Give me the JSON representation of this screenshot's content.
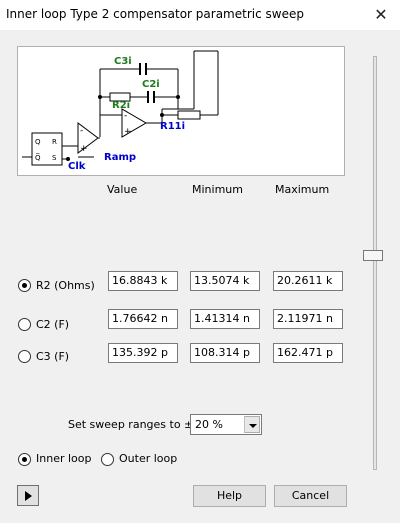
{
  "window": {
    "title": "Inner loop Type 2 compensator parametric sweep",
    "close_glyph": "✕"
  },
  "schematic": {
    "labels": {
      "c3i": "C3i",
      "c2i": "C2i",
      "r2i": "R2i",
      "r11i": "R11i",
      "ramp": "Ramp",
      "clk": "Clk",
      "q": "Q",
      "r": "R",
      "qbar": "Q̅",
      "s": "S",
      "minus": "-",
      "plus": "+"
    },
    "colors": {
      "green": "#1e7b1e",
      "blue": "#0000cc"
    }
  },
  "columns": {
    "value": "Value",
    "minimum": "Minimum",
    "maximum": "Maximum"
  },
  "rows": [
    {
      "label": "R2 (Ohms)",
      "selected": true,
      "value": "16.8843 k",
      "minimum": "13.5074 k",
      "maximum": "20.2611 k"
    },
    {
      "label": "C2 (F)",
      "selected": false,
      "value": "1.76642 n",
      "minimum": "1.41314 n",
      "maximum": "2.11971 n"
    },
    {
      "label": "C3 (F)",
      "selected": false,
      "value": "135.392 p",
      "minimum": "108.314 p",
      "maximum": "162.471 p"
    }
  ],
  "sweep": {
    "label": "Set sweep ranges to ±",
    "value": "20 %"
  },
  "loop": {
    "inner_label": "Inner loop",
    "outer_label": "Outer loop",
    "selected": "inner"
  },
  "buttons": {
    "help": "Help",
    "cancel": "Cancel"
  },
  "slider": {
    "position_fraction": 0.47
  }
}
